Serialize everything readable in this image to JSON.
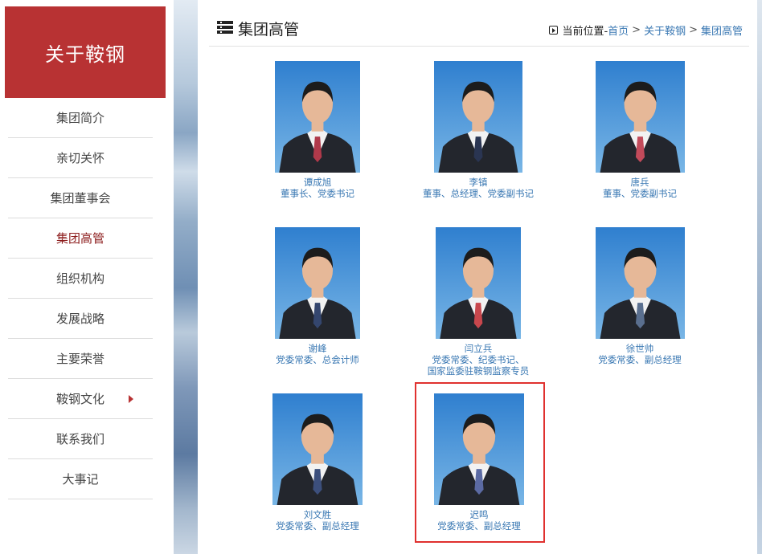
{
  "sidebar": {
    "title": "关于鞍钢",
    "items": [
      {
        "label": "集团简介"
      },
      {
        "label": "亲切关怀"
      },
      {
        "label": "集团董事会"
      },
      {
        "label": "集团高管",
        "active": true
      },
      {
        "label": "组织机构"
      },
      {
        "label": "发展战略"
      },
      {
        "label": "主要荣誉"
      },
      {
        "label": "鞍钢文化",
        "has_submenu": true
      },
      {
        "label": "联系我们"
      },
      {
        "label": "大事记"
      }
    ]
  },
  "header": {
    "title": "集团高管",
    "location_label": "当前位置-",
    "breadcrumb": [
      "首页",
      "关于鞍钢",
      "集团高管"
    ],
    "separator": ">"
  },
  "people": [
    {
      "name": "谭成旭",
      "title_lines": [
        "董事长、党委书记"
      ]
    },
    {
      "name": "李镇",
      "title_lines": [
        "董事、总经理、党委副书记"
      ]
    },
    {
      "name": "唐兵",
      "title_lines": [
        "董事、党委副书记"
      ]
    },
    {
      "name": "谢峰",
      "title_lines": [
        "党委常委、总会计师"
      ]
    },
    {
      "name": "闫立兵",
      "title_lines": [
        "党委常委、纪委书记、",
        "国家监委驻鞍钢监察专员"
      ]
    },
    {
      "name": "徐世帅",
      "title_lines": [
        "党委常委、副总经理"
      ]
    },
    {
      "name": "刘文胜",
      "title_lines": [
        "党委常委、副总经理"
      ]
    },
    {
      "name": "迟鸣",
      "title_lines": [
        "党委常委、副总经理"
      ],
      "highlighted": true
    }
  ],
  "colors": {
    "brand_red": "#b83233",
    "link_blue": "#3a78b3",
    "highlight_red": "#e0312f",
    "photo_blue": "#3f8fd2"
  }
}
